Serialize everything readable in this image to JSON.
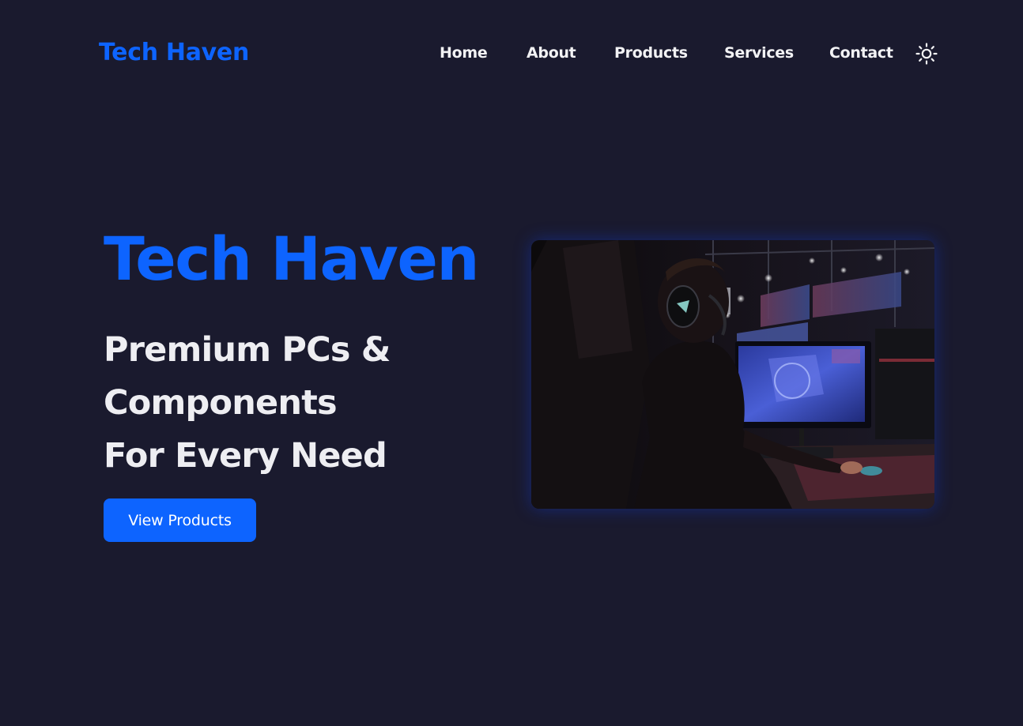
{
  "navbar": {
    "brand": "Tech Haven",
    "links": [
      {
        "label": "Home"
      },
      {
        "label": "About"
      },
      {
        "label": "Products"
      },
      {
        "label": "Services"
      },
      {
        "label": "Contact"
      }
    ],
    "theme_toggle_icon": "sun-icon"
  },
  "hero": {
    "title": "Tech Haven",
    "subtitle_lines": [
      "Premium PCs &",
      "Components",
      "For Every Need"
    ],
    "cta_label": "View Products",
    "image_icon": "gaming-setup-photo"
  },
  "colors": {
    "background": "#1a1a2e",
    "accent": "#0d64ff",
    "text": "#f2f2f4"
  }
}
